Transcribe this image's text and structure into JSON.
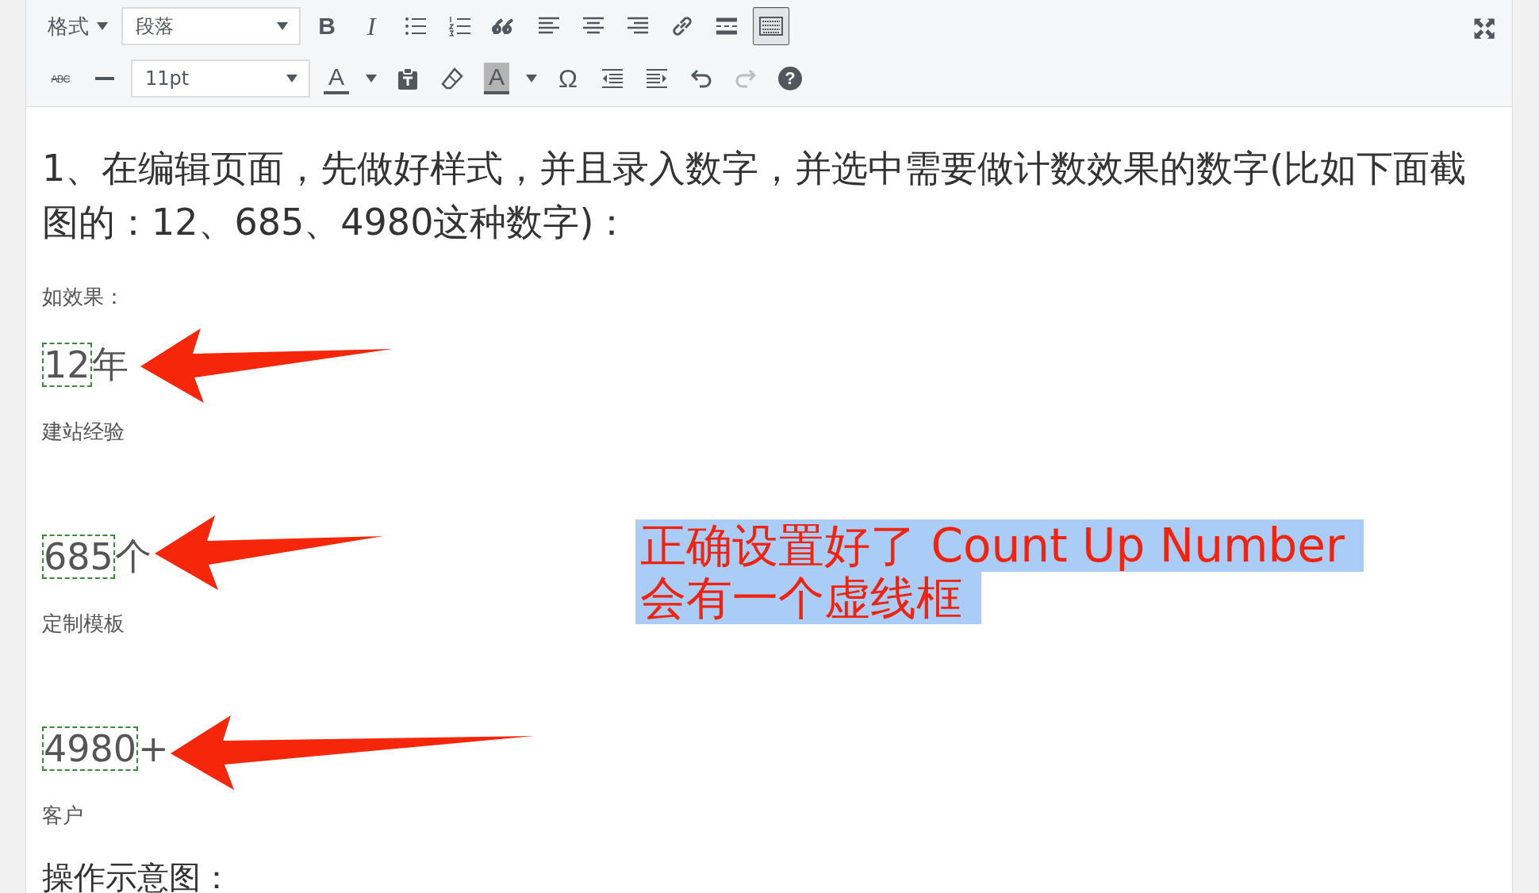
{
  "toolbar": {
    "rows": [
      {
        "items": [
          {
            "kind": "menu",
            "label": "格式"
          },
          {
            "kind": "select",
            "value": "段落"
          },
          {
            "kind": "bold",
            "label": "B"
          },
          {
            "kind": "italic",
            "label": "I"
          },
          {
            "kind": "bullets"
          },
          {
            "kind": "numbers"
          },
          {
            "kind": "quote"
          },
          {
            "kind": "alignleft"
          },
          {
            "kind": "aligncenter"
          },
          {
            "kind": "alignright"
          },
          {
            "kind": "link"
          },
          {
            "kind": "more"
          },
          {
            "kind": "toggle",
            "selected": true
          }
        ]
      },
      {
        "items": [
          {
            "kind": "strike",
            "label": "ABC"
          },
          {
            "kind": "rule"
          },
          {
            "kind": "select",
            "value": "11pt"
          },
          {
            "kind": "textcolor",
            "label": "A"
          },
          {
            "kind": "paste"
          },
          {
            "kind": "eraser"
          },
          {
            "kind": "bgcolor",
            "label": "A"
          },
          {
            "kind": "charmap",
            "label": "Ω"
          },
          {
            "kind": "outdent"
          },
          {
            "kind": "indent"
          },
          {
            "kind": "undo",
            "disabled": false
          },
          {
            "kind": "redo",
            "disabled": true
          },
          {
            "kind": "help",
            "label": "?"
          }
        ]
      }
    ]
  },
  "content": [
    {
      "kind": "lead",
      "text": "1、在编辑页面，先做好样式，并且录入数字，并选中需要做计数效果的数字(比如下面截图的：12、685、4980这种数字)："
    },
    {
      "kind": "caption",
      "text": "如效果："
    },
    {
      "kind": "counter",
      "number": "12",
      "suffix": "年"
    },
    {
      "kind": "caption",
      "text": "建站经验"
    },
    {
      "kind": "counter",
      "number": "685",
      "suffix": "个"
    },
    {
      "kind": "caption",
      "text": "定制模板"
    },
    {
      "kind": "counter",
      "number": "4980",
      "suffix": "+"
    },
    {
      "kind": "caption",
      "text": "客户"
    },
    {
      "kind": "heading",
      "text": "操作示意图："
    }
  ],
  "annotation": {
    "lines": [
      "正确设置好了 Count Up Number",
      "会有一个虚线框"
    ]
  }
}
